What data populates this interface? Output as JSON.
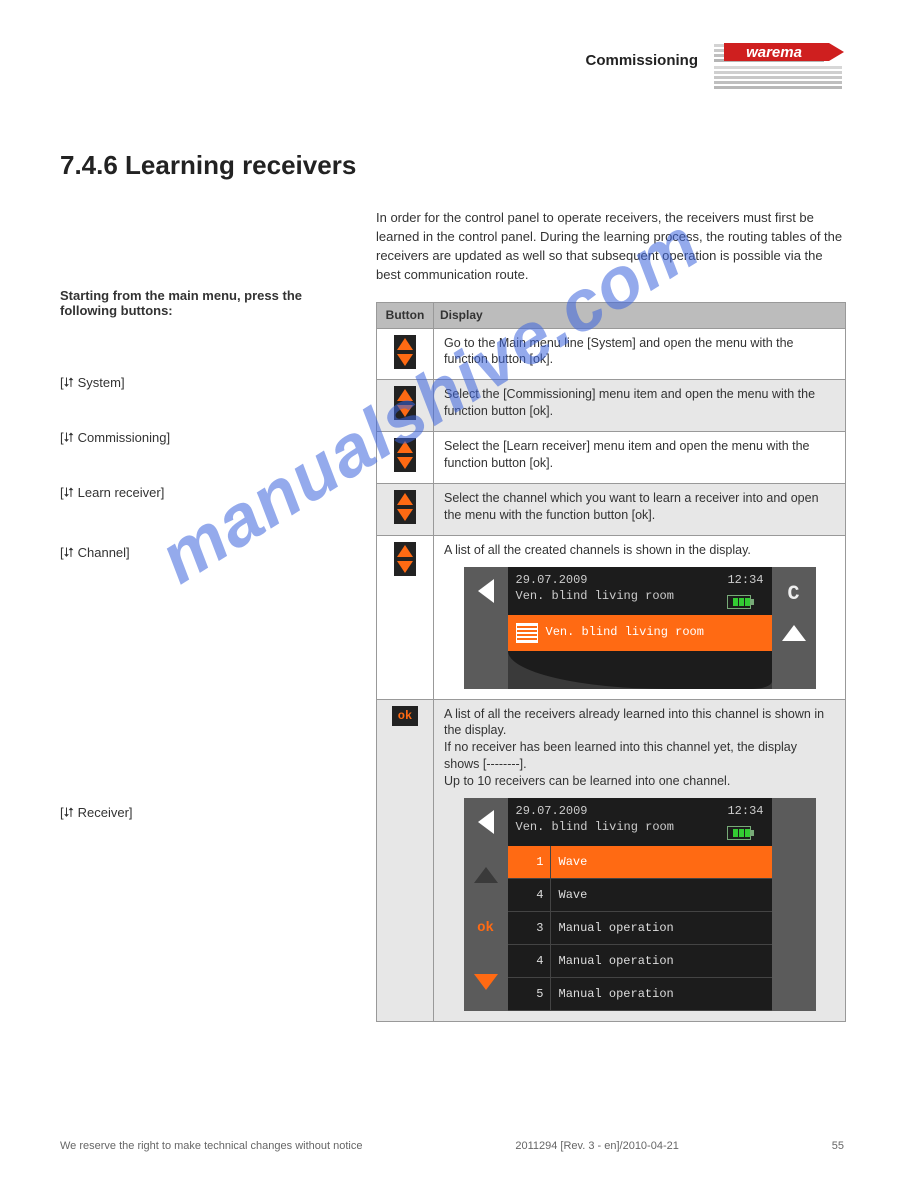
{
  "header_right": "Commissioning",
  "section_title": "7.4.6 Learning receivers",
  "intro": "In order for the control panel to operate receivers, the receivers must first be learned in the control panel. During the learning process, the routing tables of the receivers are updated as well so that subsequent operation is possible via the best communication route.",
  "side": {
    "lead": "Starting from the main menu, press the following buttons:",
    "sub1": "[⮃ System]",
    "sub2": "[⮃ Commissioning]",
    "sub3": "[⮃ Learn receiver]",
    "sub4": "[⮃ Channel]",
    "sub5": "[⮃ Receiver]"
  },
  "table": {
    "hdr_button": "Button",
    "hdr_display": "Display",
    "r1": "Go to the Main menu line [System] and open the menu with the function button [ok].",
    "r2": "Select the [Commissioning] menu item and open the menu with the function button [ok].",
    "r3": "Select the [Learn receiver] menu item and open the menu with the function button [ok].",
    "r4": "Select the channel which you want to learn a receiver into and open the menu with the function button [ok].",
    "r5": "A list of all the created channels is shown in the display.",
    "r6a": "A list of all the receivers already learned into this channel is shown in the display.",
    "r6b": "If no receiver has been learned into this channel yet, the display shows [--------].",
    "r6c": "Up to 10 receivers can be learned into one channel."
  },
  "screen1": {
    "date": "29.07.2009",
    "time": "12:34",
    "title": "Ven. blind living room",
    "sel": "Ven. blind living room",
    "side_c": "C"
  },
  "screen2": {
    "date": "29.07.2009",
    "time": "12:34",
    "title": "Ven. blind living room",
    "ok": "ok",
    "rows": [
      {
        "n": "1",
        "t": "Wave",
        "sel": true
      },
      {
        "n": "4",
        "t": "Wave"
      },
      {
        "n": "3",
        "t": "Manual operation"
      },
      {
        "n": "4",
        "t": "Manual operation"
      },
      {
        "n": "5",
        "t": "Manual operation"
      }
    ]
  },
  "footer": {
    "left": "We reserve the right to make technical changes without notice",
    "mid": "2011294 [Rev. 3 - en]/2010-04-21",
    "right": "55"
  },
  "watermark": "manualshive.com"
}
